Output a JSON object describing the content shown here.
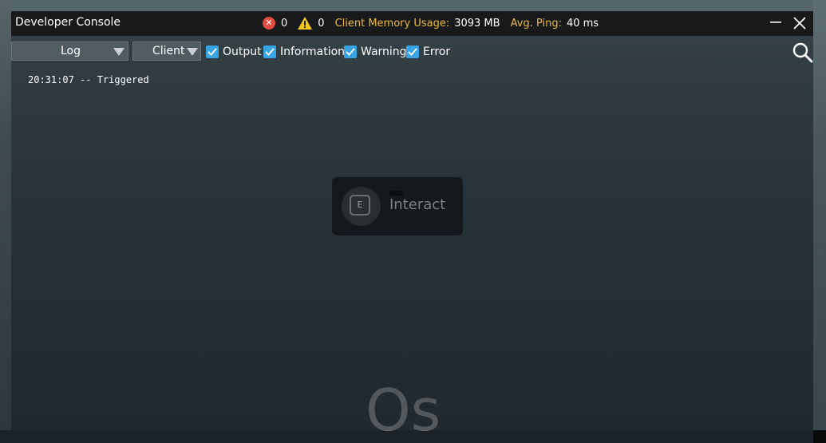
{
  "window": {
    "title": "Developer Console"
  },
  "stats": {
    "error_count": "0",
    "warning_count": "0",
    "memory_label": "Client Memory Usage:",
    "memory_value": "3093 MB",
    "ping_label": "Avg. Ping:",
    "ping_value": "40 ms"
  },
  "toolbar": {
    "view_select": "Log",
    "context_select": "Client",
    "filters": [
      {
        "label": "Output",
        "checked": true
      },
      {
        "label": "Information",
        "checked": true
      },
      {
        "label": "Warning",
        "checked": true
      },
      {
        "label": "Error",
        "checked": true
      }
    ]
  },
  "log": {
    "lines": [
      "20:31:07 -- Triggered"
    ]
  },
  "interact_prompt": {
    "key": "E",
    "action": "Interact"
  },
  "background_text": "Os",
  "colors": {
    "titlebar": "#17191b",
    "accent_yellow": "#f0b93a",
    "checkbox_blue": "#3aa3e3",
    "error_red": "#e04a3f",
    "warning_yellow": "#f5c518"
  },
  "icons": {
    "error": "error-circle-icon",
    "warning": "warning-triangle-icon",
    "minimize": "minimize-icon",
    "close": "close-icon",
    "search": "search-icon",
    "dropdown": "chevron-down-icon",
    "check": "checkmark-icon"
  }
}
